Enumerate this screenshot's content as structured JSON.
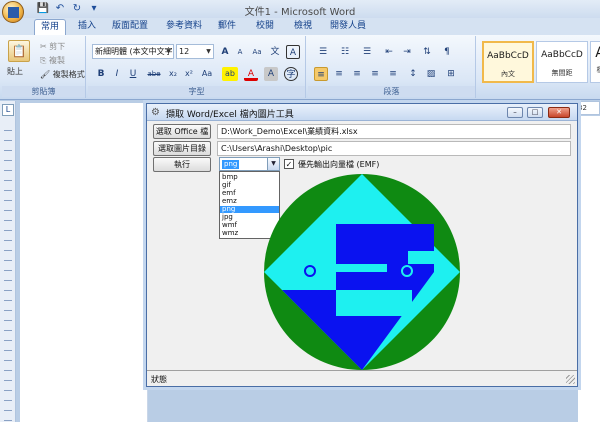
{
  "window": {
    "title": "文件1 - Microsoft Word",
    "qat": {
      "save": "💾",
      "undo": "↶",
      "redo": "↻",
      "customize": "▾"
    }
  },
  "tabs": [
    {
      "label": "常用",
      "active": true
    },
    {
      "label": "插入",
      "active": false
    },
    {
      "label": "版面配置",
      "active": false
    },
    {
      "label": "參考資料",
      "active": false
    },
    {
      "label": "郵件",
      "active": false
    },
    {
      "label": "校閱",
      "active": false
    },
    {
      "label": "檢視",
      "active": false
    },
    {
      "label": "開發人員",
      "active": false
    }
  ],
  "ribbon": {
    "clipboard": {
      "paste": "貼上",
      "cut": "剪下",
      "copy": "複製",
      "format_painter": "複製格式",
      "label": "剪貼簿"
    },
    "font": {
      "name": "新細明體 (本文中文字",
      "size": "12",
      "label": "字型",
      "grow": "A",
      "shrink": "A",
      "clear": "Aa",
      "phonetic": "文",
      "border": "A",
      "bold": "B",
      "italic": "I",
      "underline": "U",
      "strike": "abe",
      "subscript": "x₂",
      "superscript": "x²",
      "case": "Aa",
      "highlight": "ab",
      "color": "A",
      "shade": "A",
      "encircle": "字"
    },
    "paragraph": {
      "label": "段落",
      "bullets": "☰",
      "numbering": "☷",
      "multilevel": "☰",
      "decrease": "⇤",
      "increase": "⇥",
      "sort": "⇅",
      "marks": "¶"
    },
    "styles": [
      {
        "sample": "AaBbCcD",
        "name": "內文",
        "selected": true
      },
      {
        "sample": "AaBbCcD",
        "name": "無間距",
        "selected": false
      },
      {
        "sample": "A",
        "name": "標",
        "selected": false
      }
    ]
  },
  "rulers": {
    "corner": "L",
    "right_value": "32"
  },
  "dialog": {
    "title": "擷取 Word/Excel 檔內圖片工具",
    "minimize": "–",
    "maximize": "□",
    "close": "✕",
    "select_office_button": "選取 Office 檔",
    "office_path": "D:\\Work_Demo\\Excel\\業績資料.xlsx",
    "select_folder_button": "選取圖片目錄",
    "folder_path": "C:\\Users\\Arashi\\Desktop\\pic",
    "run_button": "執行",
    "format": {
      "selected": "png",
      "options": [
        "bmp",
        "gif",
        "emf",
        "emz",
        "png",
        "jpg",
        "wmf",
        "wmz"
      ]
    },
    "emf_checkbox": {
      "checked": true,
      "mark": "✓",
      "label": "優先輸出向量檔 (EMF)"
    },
    "preview_colors": {
      "circle": "#0f8a12",
      "diamond": "#1ef0f0",
      "shape": "#0a12f0",
      "eye": "#1ef0f0"
    },
    "status": "狀態"
  }
}
